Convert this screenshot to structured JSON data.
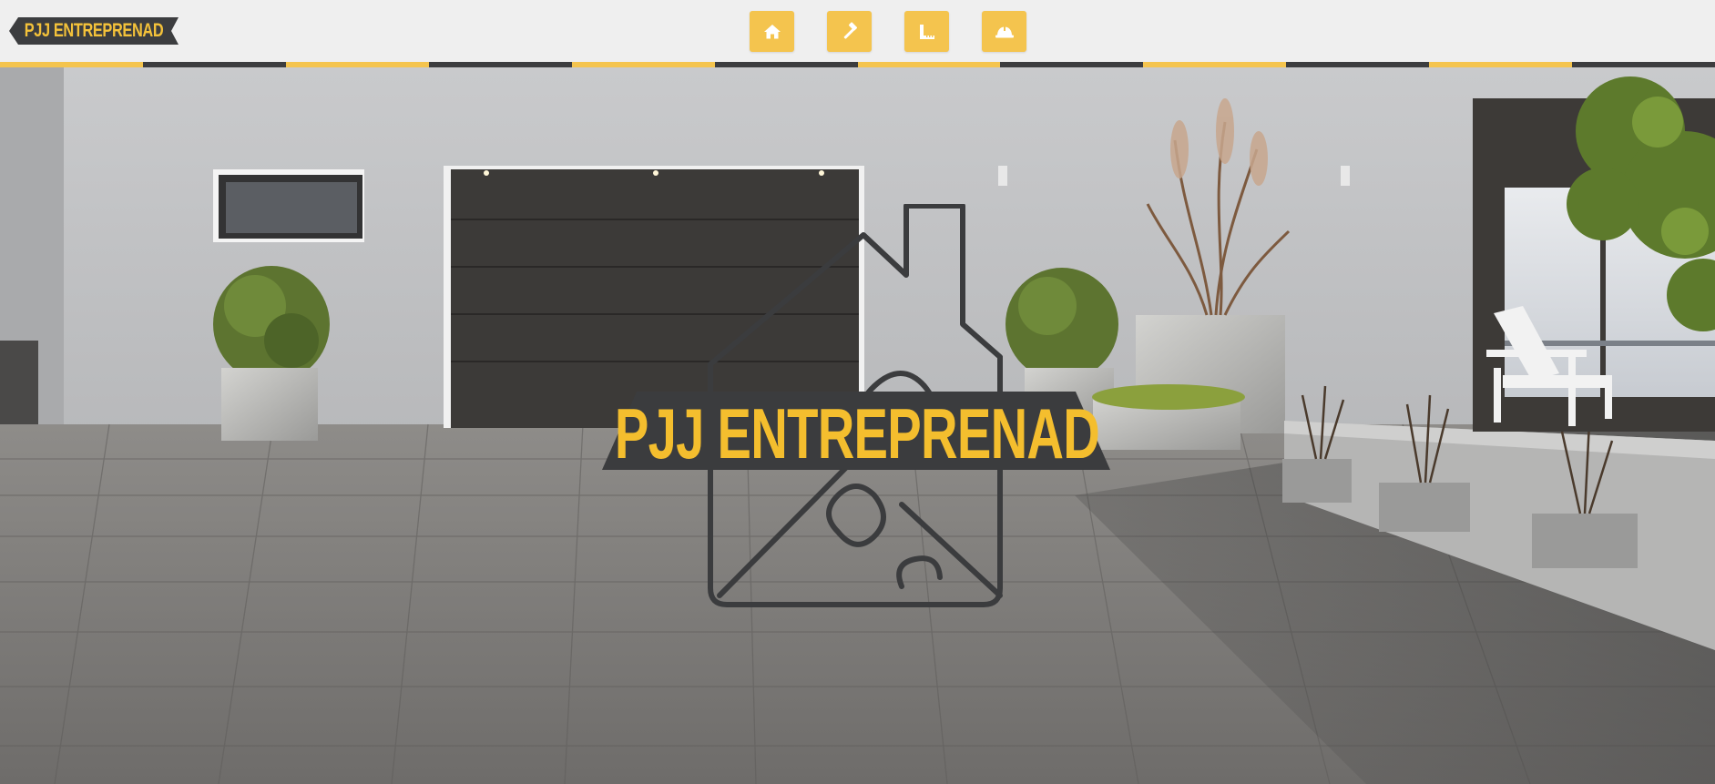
{
  "brand": {
    "name": "PJJ ENTREPRENAD",
    "colors": {
      "accent": "#f4c44e",
      "dark": "#3c3d3f",
      "background": "#efefef"
    }
  },
  "nav": {
    "items": [
      {
        "icon": "home-icon"
      },
      {
        "icon": "hammer-icon"
      },
      {
        "icon": "ruler-icon"
      },
      {
        "icon": "hard-hat-icon"
      }
    ]
  },
  "hero": {
    "logo_text": "PJJ ENTREPRENAD",
    "logo_icon": "house-puzzle-icon"
  }
}
